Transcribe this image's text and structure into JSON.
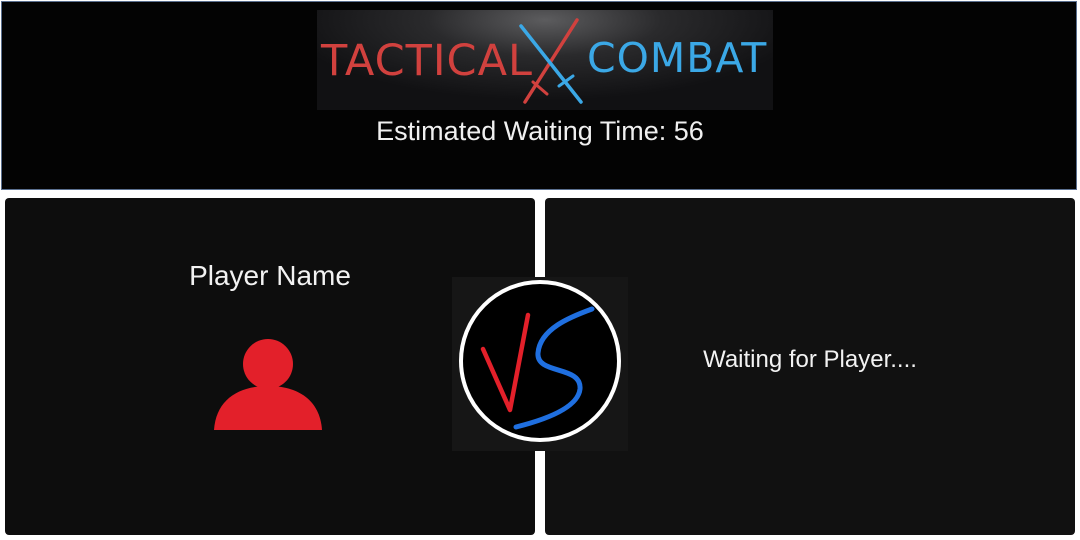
{
  "header": {
    "logo": {
      "left_word": "TACTICAL",
      "right_word": "COMBAT",
      "left_color": "#d1413e",
      "right_color": "#3ba8e6"
    },
    "wait_label": "Estimated Waiting Time: 56"
  },
  "players": {
    "left": {
      "name": "Player Name",
      "avatar_icon": "user-silhouette-icon",
      "avatar_color": "#e3202a"
    },
    "right": {
      "status": "Waiting for Player...."
    }
  },
  "vs_badge": {
    "icon": "vs-icon",
    "v_color": "#e3202a",
    "s_color": "#1f6fe0"
  }
}
